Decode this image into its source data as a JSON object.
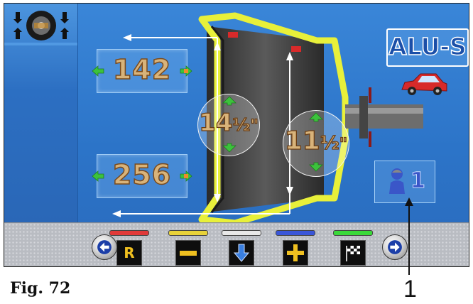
{
  "left_panel": {
    "icon": "wheel-balancer-icon"
  },
  "dimensions": {
    "upper_value": "142",
    "lower_value": "256"
  },
  "rim_type": {
    "label": "ALU-S"
  },
  "rim_diameters": {
    "outer": {
      "whole": "14",
      "fraction": "½",
      "unit": "\""
    },
    "inner": {
      "whole": "11",
      "fraction": "½",
      "unit": "\""
    }
  },
  "operator": {
    "icon": "operator-icon",
    "number": "1"
  },
  "toolbar": {
    "keys": [
      {
        "label": "R",
        "bar_color": "#e03a3a",
        "icon": "reset-icon"
      },
      {
        "label": "",
        "bar_color": "#e8d23a",
        "icon": "minus-icon"
      },
      {
        "label": "",
        "bar_color": "#e8e8e8",
        "icon": "arrow-down-icon"
      },
      {
        "label": "",
        "bar_color": "#3a56d8",
        "icon": "plus-icon"
      },
      {
        "label": "",
        "bar_color": "#3ad83a",
        "icon": "checkered-flag-icon"
      }
    ]
  },
  "caption": {
    "figure": "Fig. 72"
  },
  "callout": {
    "number": "1"
  },
  "colors": {
    "screen_blue": "#2c74c8",
    "value_gold": "#d8b37a",
    "rim_yellow": "#e8f03a",
    "arrow_green": "#3cc23c",
    "arrow_orange": "#f08a2a"
  }
}
